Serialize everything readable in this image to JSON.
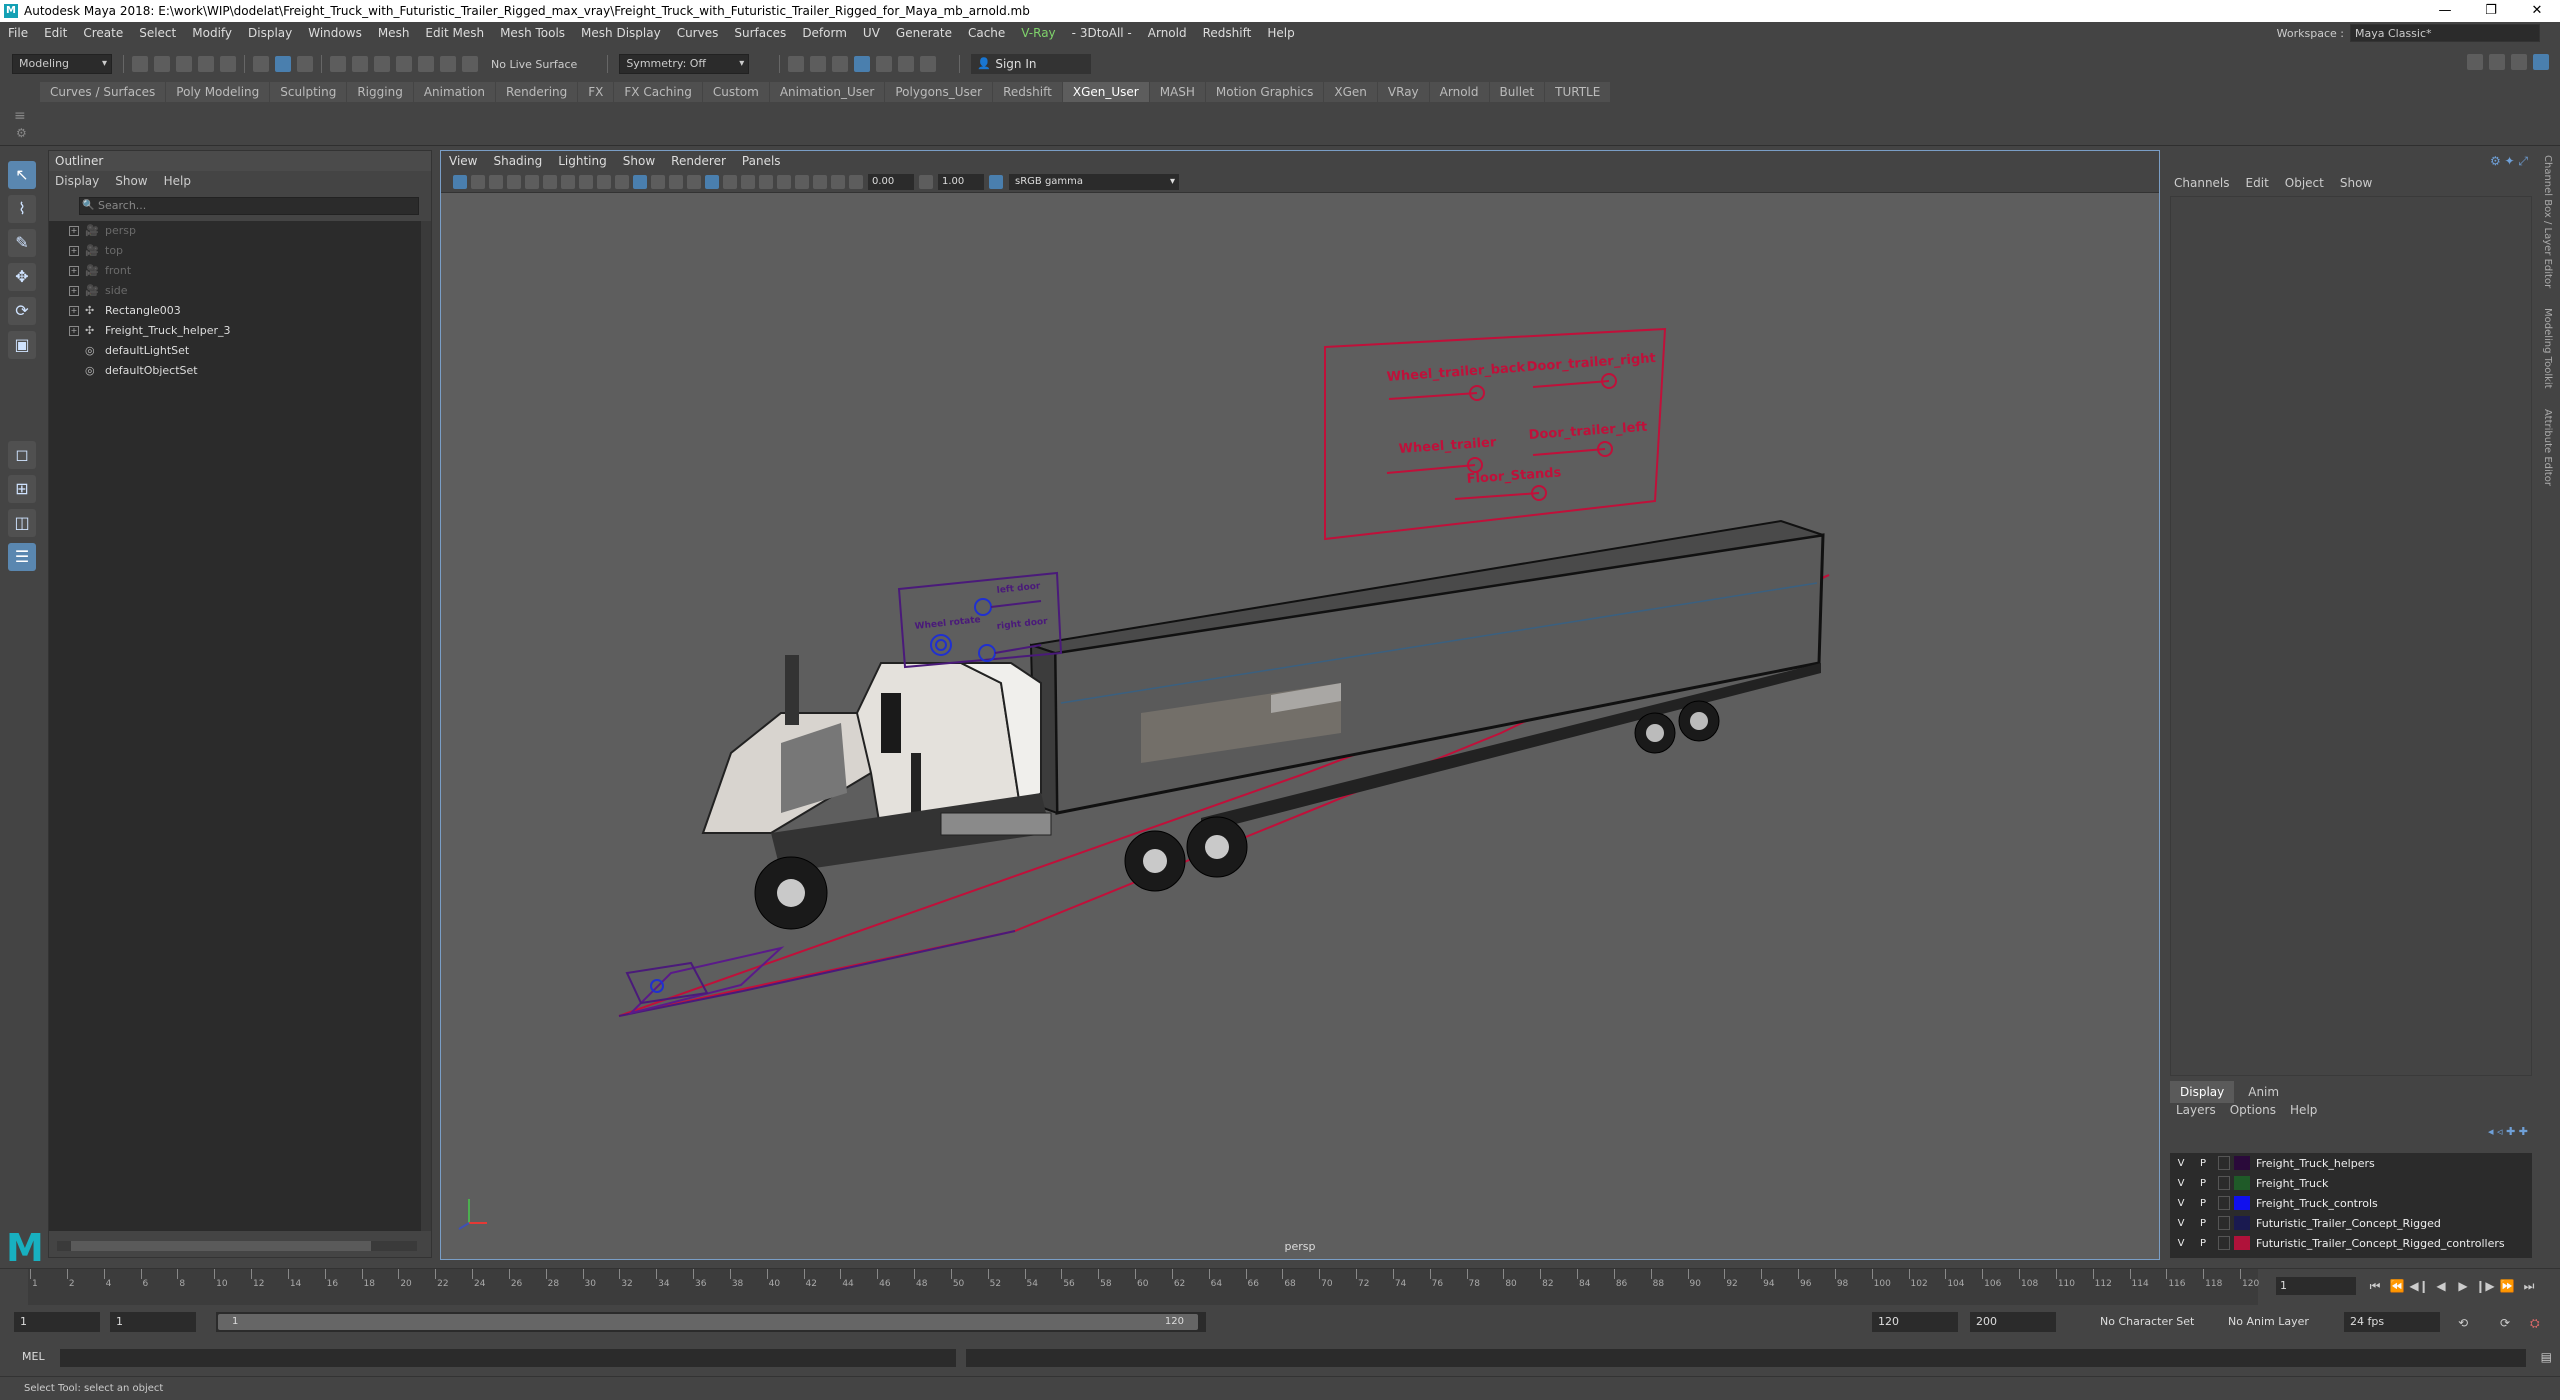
{
  "window": {
    "title": "Autodesk Maya 2018: E:\\work\\WIP\\dodelat\\Freight_Truck_with_Futuristic_Trailer_Rigged_max_vray\\Freight_Truck_with_Futuristic_Trailer_Rigged_for_Maya_mb_arnold.mb",
    "min": "—",
    "restore": "❐",
    "close": "✕"
  },
  "menubar": {
    "items": [
      "File",
      "Edit",
      "Create",
      "Select",
      "Modify",
      "Display",
      "Windows",
      "Mesh",
      "Edit Mesh",
      "Mesh Tools",
      "Mesh Display",
      "Curves",
      "Surfaces",
      "Deform",
      "UV",
      "Generate",
      "Cache",
      "V-Ray",
      "- 3DtoAll -",
      "Arnold",
      "Redshift",
      "Help"
    ]
  },
  "workspace": {
    "label": "Workspace :",
    "value": "Maya Classic*"
  },
  "statusline": {
    "mode": "Modeling",
    "live_surface": "No Live Surface",
    "symmetry": "Symmetry: Off",
    "sign_in": "Sign In"
  },
  "shelf": {
    "tabs": [
      "Curves / Surfaces",
      "Poly Modeling",
      "Sculpting",
      "Rigging",
      "Animation",
      "Rendering",
      "FX",
      "FX Caching",
      "Custom",
      "Animation_User",
      "Polygons_User",
      "Redshift",
      "XGen_User",
      "MASH",
      "Motion Graphics",
      "XGen",
      "VRay",
      "Arnold",
      "Bullet",
      "TURTLE"
    ],
    "active": "XGen_User"
  },
  "outliner": {
    "title": "Outliner",
    "menu": [
      "Display",
      "Show",
      "Help"
    ],
    "search_placeholder": "Search...",
    "nodes": [
      {
        "name": "persp",
        "icon": "camera-icon",
        "dim": true,
        "expand": true
      },
      {
        "name": "top",
        "icon": "camera-icon",
        "dim": true,
        "expand": true
      },
      {
        "name": "front",
        "icon": "camera-icon",
        "dim": true,
        "expand": true
      },
      {
        "name": "side",
        "icon": "camera-icon",
        "dim": true,
        "expand": true
      },
      {
        "name": "Rectangle003",
        "icon": "transform-icon",
        "dim": false,
        "expand": true
      },
      {
        "name": "Freight_Truck_helper_3",
        "icon": "transform-icon",
        "dim": false,
        "expand": true
      },
      {
        "name": "defaultLightSet",
        "icon": "set-icon",
        "dim": false,
        "expand": false
      },
      {
        "name": "defaultObjectSet",
        "icon": "set-icon",
        "dim": false,
        "expand": false
      }
    ]
  },
  "viewport": {
    "menu": [
      "View",
      "Shading",
      "Lighting",
      "Show",
      "Renderer",
      "Panels"
    ],
    "exposure": "0.00",
    "gamma": "1.00",
    "colorspace": "sRGB gamma",
    "camera_label": "persp",
    "control_labels": {
      "wheel_trailer_back": "Wheel_trailer_back",
      "door_trailer_right": "Door_trailer_right",
      "wheel_trailer": "Wheel_trailer",
      "door_trailer_left": "Door_trailer_left",
      "floor_stands": "Floor_Stands",
      "left_door": "left door",
      "wheel_rotate": "Wheel rotate",
      "right_door": "right door"
    }
  },
  "channelbox": {
    "menu": [
      "Channels",
      "Edit",
      "Object",
      "Show"
    ]
  },
  "sidetabs": [
    "Channel Box / Layer Editor",
    "Modeling Toolkit",
    "Attribute Editor"
  ],
  "layereditor": {
    "tabs": [
      "Display",
      "Anim"
    ],
    "menu": [
      "Layers",
      "Options",
      "Help"
    ],
    "layers": [
      {
        "v": "V",
        "p": "P",
        "name": "Freight_Truck_helpers",
        "color": "#2a0a3a"
      },
      {
        "v": "V",
        "p": "P",
        "name": "Freight_Truck",
        "color": "#1f5a28"
      },
      {
        "v": "V",
        "p": "P",
        "name": "Freight_Truck_controls",
        "color": "#1010ee"
      },
      {
        "v": "V",
        "p": "P",
        "name": "Futuristic_Trailer_Concept_Rigged",
        "color": "#1a1a50"
      },
      {
        "v": "V",
        "p": "P",
        "name": "Futuristic_Trailer_Concept_Rigged_controllers",
        "color": "#b0123a"
      }
    ]
  },
  "timeline": {
    "ticks": [
      "1",
      "2",
      "4",
      "6",
      "8",
      "10",
      "12",
      "14",
      "16",
      "18",
      "20",
      "22",
      "24",
      "26",
      "28",
      "30",
      "32",
      "34",
      "36",
      "38",
      "40",
      "42",
      "44",
      "46",
      "48",
      "50",
      "52",
      "54",
      "56",
      "58",
      "60",
      "62",
      "64",
      "66",
      "68",
      "70",
      "72",
      "74",
      "76",
      "78",
      "80",
      "82",
      "84",
      "86",
      "88",
      "90",
      "92",
      "94",
      "96",
      "98",
      "100",
      "102",
      "104",
      "106",
      "108",
      "110",
      "112",
      "114",
      "116",
      "118",
      "120"
    ],
    "current_frame": "1",
    "controls": [
      "⏮",
      "⏪",
      "◀❙",
      "◀",
      "▶",
      "❙▶",
      "⏩",
      "⏭"
    ]
  },
  "range": {
    "start": "1",
    "playback_start": "1",
    "slider_start": "1",
    "slider_end": "120",
    "playback_end": "120",
    "end": "200",
    "character_set": "No Character Set",
    "anim_layer": "No Anim Layer",
    "fps": "24 fps"
  },
  "cmdline": {
    "label": "MEL"
  },
  "helpline": {
    "text": "Select Tool: select an object"
  },
  "colors": {
    "accent": "#5a87b0",
    "control_red": "#c0103a",
    "control_purple": "#4a1a7a",
    "control_blue": "#2030d0"
  }
}
